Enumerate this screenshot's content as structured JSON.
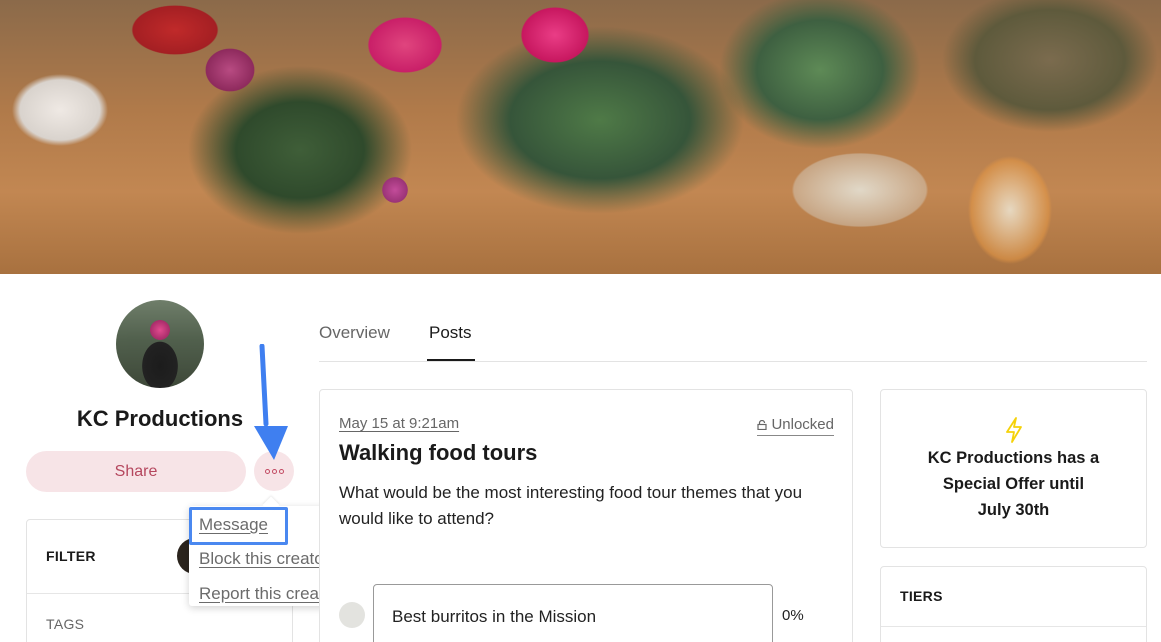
{
  "creator": {
    "name": "KC Productions",
    "share_label": "Share",
    "more_icon": "more-horizontal-icon"
  },
  "menu": {
    "items": [
      "Message",
      "Block this creator",
      "Report this creator"
    ],
    "highlighted": "Message"
  },
  "filter": {
    "title": "FILTER",
    "tags_label": "TAGS"
  },
  "tabs": [
    {
      "label": "Overview",
      "active": false
    },
    {
      "label": "Posts",
      "active": true
    }
  ],
  "post": {
    "date": "May 15 at 9:21am",
    "status": "Unlocked",
    "title": "Walking food tours",
    "body": "What would be the most interesting food tour themes that you would like to attend?",
    "poll": [
      {
        "option": "Best burritos in the Mission",
        "percent": "0%"
      }
    ]
  },
  "offer": {
    "line1": "KC Productions has a",
    "line2": "Special Offer until",
    "line3": "July 30th",
    "icon": "lightning-bolt-icon"
  },
  "tiers": {
    "title": "TIERS"
  },
  "colors": {
    "accent_pink": "#f7e4e7",
    "accent_text": "#b5475e",
    "highlight_blue": "#4a88f0",
    "bolt_yellow": "#f5d20a"
  }
}
